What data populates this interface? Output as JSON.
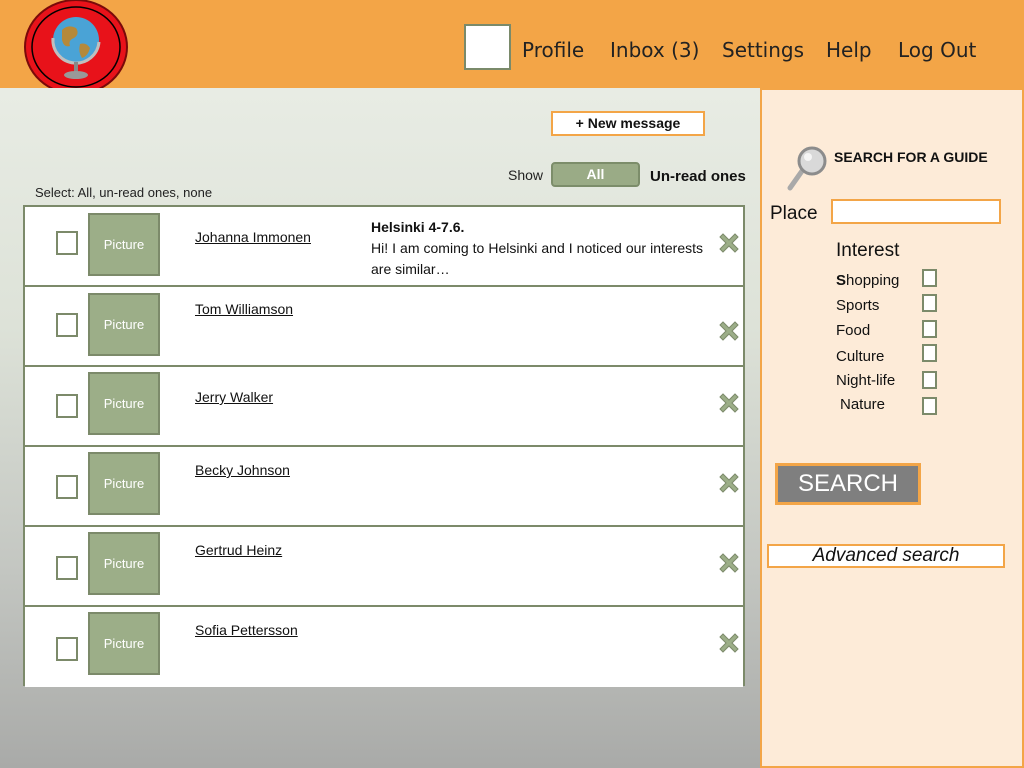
{
  "header": {
    "nav": [
      {
        "label": "Profile"
      },
      {
        "label": "Inbox (3)"
      },
      {
        "label": "Settings"
      },
      {
        "label": "Help"
      },
      {
        "label": "Log Out"
      }
    ]
  },
  "messages": {
    "new_message_label": "+ New message",
    "show_label": "Show",
    "show_all_label": "All",
    "unread_label": "Un-read ones",
    "select_label": "Select: All, un-read ones, none",
    "picture_label": "Picture",
    "rows": [
      {
        "name": "Johanna Immonen",
        "subject": "Helsinki 4-7.6.",
        "preview": "Hi! I am coming to Helsinki and I noticed our interests are similar…"
      },
      {
        "name": "Tom Williamson"
      },
      {
        "name": "Jerry Walker"
      },
      {
        "name": "Becky Johnson"
      },
      {
        "name": "Gertrud Heinz"
      },
      {
        "name": "Sofia Pettersson"
      }
    ]
  },
  "sidebar": {
    "search_title": "SEARCH FOR A GUIDE",
    "place_label": "Place",
    "place_value": "",
    "interest_title": "Interest",
    "interests": [
      {
        "first": "S",
        "rest": "hopping"
      },
      {
        "first": "",
        "rest": "Sports"
      },
      {
        "first": "",
        "rest": "Food"
      },
      {
        "first": "",
        "rest": "Culture"
      },
      {
        "first": "",
        "rest": "Night-life"
      },
      {
        "first": "",
        "rest": "Nature"
      }
    ],
    "search_button": "SEARCH",
    "advanced_search": "Advanced search"
  },
  "colors": {
    "header_bg": "#f3a547",
    "accent_green": "#9aab86",
    "sidebar_bg": "#fdebd8",
    "search_button_bg": "#7f7f7f"
  },
  "icons": {
    "logo": "globe-icon",
    "delete": "close-x-icon",
    "search": "magnifier-icon"
  }
}
